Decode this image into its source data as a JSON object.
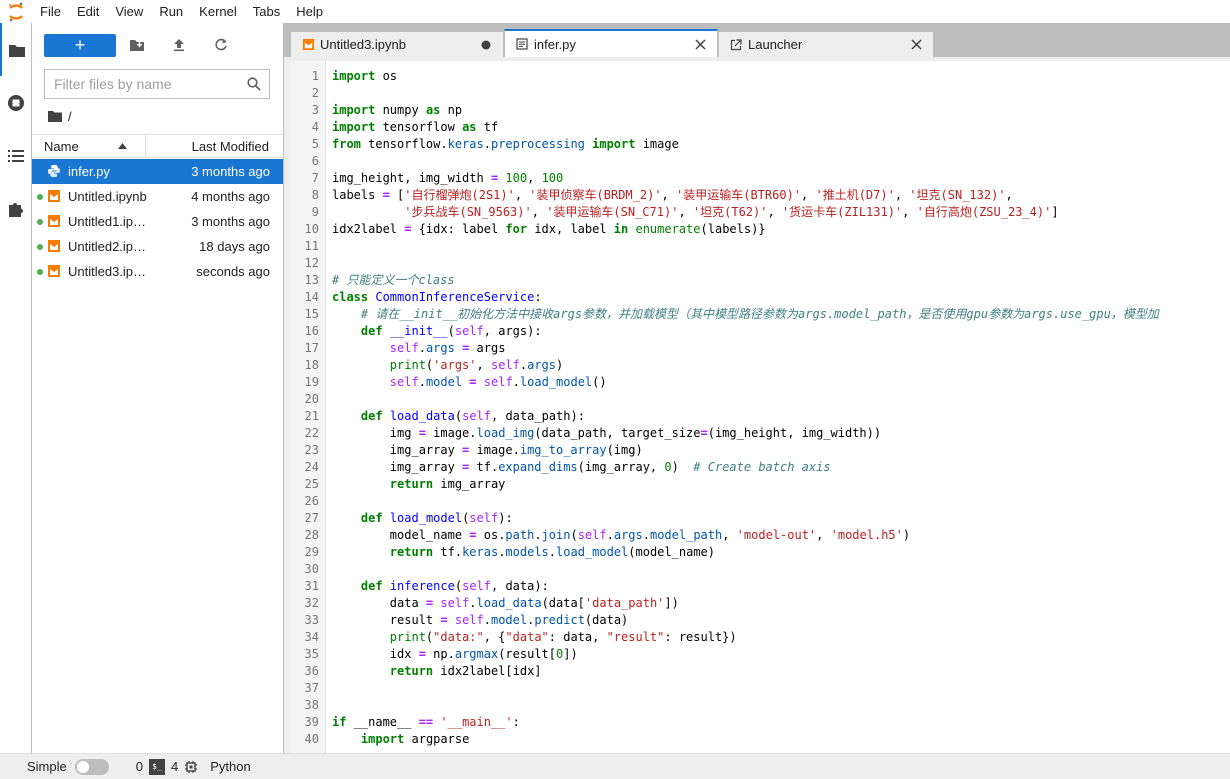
{
  "menu": {
    "items": [
      "File",
      "Edit",
      "View",
      "Run",
      "Kernel",
      "Tabs",
      "Help"
    ]
  },
  "colors": {
    "accent": "#1976d2",
    "notebook_orange": "#f57c00",
    "kernel_dot": "#4caf50"
  },
  "sidebar": {
    "icons": [
      "folder-icon",
      "running-icon",
      "commands-icon",
      "extensions-icon"
    ]
  },
  "filebrowser": {
    "new_label": "+",
    "search_placeholder": "Filter files by name",
    "breadcrumb": "/",
    "header": {
      "name": "Name",
      "modified": "Last Modified"
    },
    "files": [
      {
        "name": "infer.py",
        "modified": "3 months ago",
        "type": "python",
        "selected": true,
        "running": false
      },
      {
        "name": "Untitled.ipynb",
        "modified": "4 months ago",
        "type": "notebook",
        "selected": false,
        "running": true
      },
      {
        "name": "Untitled1.ipynb",
        "modified": "3 months ago",
        "type": "notebook",
        "selected": false,
        "running": true
      },
      {
        "name": "Untitled2.ipynb",
        "modified": "18 days ago",
        "type": "notebook",
        "selected": false,
        "running": true
      },
      {
        "name": "Untitled3.ipynb",
        "modified": "seconds ago",
        "type": "notebook",
        "selected": false,
        "running": true
      }
    ]
  },
  "tabs": [
    {
      "label": "Untitled3.ipynb",
      "icon": "notebook-icon",
      "dirty": true,
      "active": false
    },
    {
      "label": "infer.py",
      "icon": "text-file-icon",
      "dirty": false,
      "active": true
    },
    {
      "label": "Launcher",
      "icon": "launcher-icon",
      "dirty": false,
      "active": false
    }
  ],
  "editor": {
    "lines": [
      "import os",
      "",
      "import numpy as np",
      "import tensorflow as tf",
      "from tensorflow.keras.preprocessing import image",
      "",
      "img_height, img_width = 100, 100",
      "labels = ['自行榴弹炮(2S1)', '装甲侦察车(BRDM_2)', '装甲运输车(BTR60)', '推土机(D7)', '坦克(SN_132)',",
      "          '步兵战车(SN_9563)', '装甲运输车(SN_C71)', '坦克(T62)', '货运卡车(ZIL131)', '自行高炮(ZSU_23_4)']",
      "idx2label = {idx: label for idx, label in enumerate(labels)}",
      "",
      "",
      "# 只能定义一个class",
      "class CommonInferenceService:",
      "    # 请在__init__初始化方法中接收args参数，并加载模型（其中模型路径参数为args.model_path，是否使用gpu参数为args.use_gpu，模型加",
      "    def __init__(self, args):",
      "        self.args = args",
      "        print('args', self.args)",
      "        self.model = self.load_model()",
      "",
      "    def load_data(self, data_path):",
      "        img = image.load_img(data_path, target_size=(img_height, img_width))",
      "        img_array = image.img_to_array(img)",
      "        img_array = tf.expand_dims(img_array, 0)  # Create batch axis",
      "        return img_array",
      "",
      "    def load_model(self):",
      "        model_name = os.path.join(self.args.model_path, 'model-out', 'model.h5')",
      "        return tf.keras.models.load_model(model_name)",
      "",
      "    def inference(self, data):",
      "        data = self.load_data(data['data_path'])",
      "        result = self.model.predict(data)",
      "        print(\"data:\", {\"data\": data, \"result\": result})",
      "        idx = np.argmax(result[0])",
      "        return idx2label[idx]",
      "",
      "",
      "if __name__ == '__main__':",
      "    import argparse"
    ]
  },
  "statusbar": {
    "mode_label": "Simple",
    "terminals_count": "0",
    "terminal_icon_text": "$_",
    "kernels_count": "4",
    "language": "Python"
  }
}
